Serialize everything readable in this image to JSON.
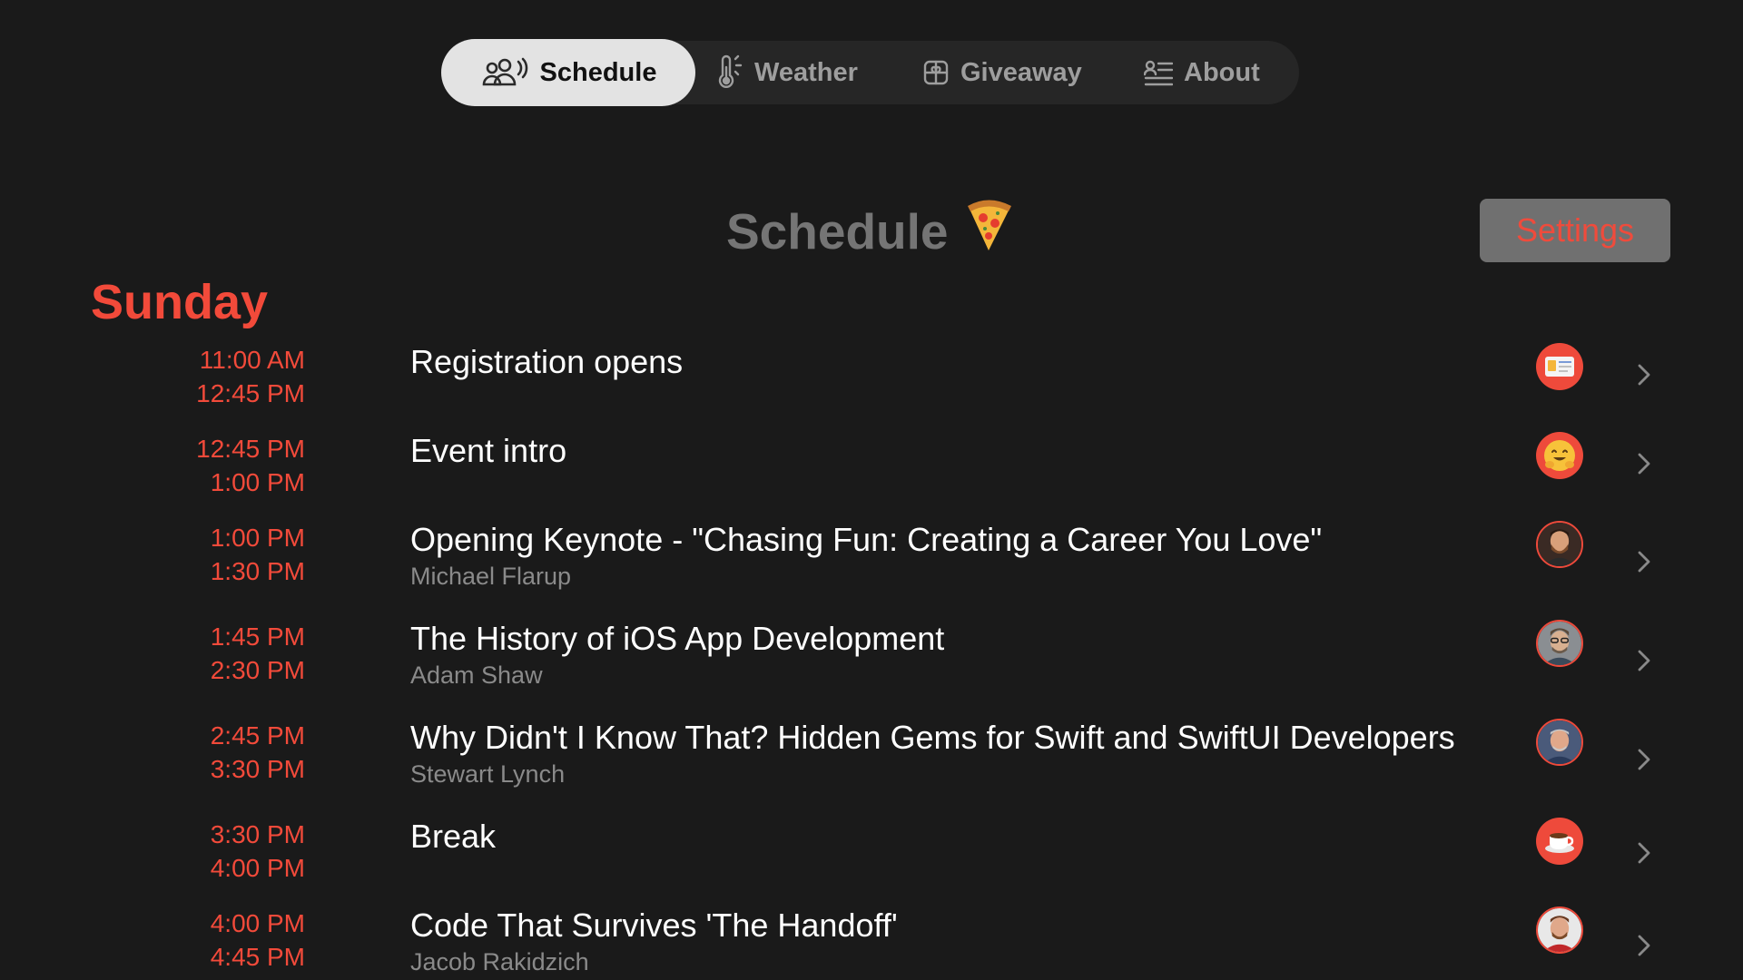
{
  "tabs": {
    "schedule": "Schedule",
    "weather": "Weather",
    "giveaway": "Giveaway",
    "about": "About",
    "active": "schedule"
  },
  "header": {
    "title": "Schedule",
    "title_emoji": "pizza-icon",
    "settings_label": "Settings"
  },
  "day": "Sunday",
  "events": [
    {
      "start": "11:00 AM",
      "end": "12:45 PM",
      "title": "Registration opens",
      "speaker": "",
      "avatar": "id-card-icon"
    },
    {
      "start": "12:45 PM",
      "end": "1:00 PM",
      "title": "Event intro",
      "speaker": "",
      "avatar": "hugging-face-icon"
    },
    {
      "start": "1:00 PM",
      "end": "1:30 PM",
      "title": "Opening Keynote - \"Chasing Fun: Creating a Career You Love\"",
      "speaker": "Michael Flarup",
      "avatar": "speaker-photo"
    },
    {
      "start": "1:45 PM",
      "end": "2:30 PM",
      "title": "The History of iOS App Development",
      "speaker": "Adam Shaw",
      "avatar": "speaker-photo"
    },
    {
      "start": "2:45 PM",
      "end": "3:30 PM",
      "title": "Why Didn't I Know That? Hidden Gems for Swift and SwiftUI Developers",
      "speaker": "Stewart Lynch",
      "avatar": "speaker-photo"
    },
    {
      "start": "3:30 PM",
      "end": "4:00 PM",
      "title": "Break",
      "speaker": "",
      "avatar": "coffee-icon"
    },
    {
      "start": "4:00 PM",
      "end": "4:45 PM",
      "title": "Code That Survives 'The Handoff'",
      "speaker": "Jacob Rakidzich",
      "avatar": "speaker-photo"
    }
  ],
  "colors": {
    "accent": "#f24a3a",
    "background": "#1a1a1a",
    "tab_bar": "#262626",
    "active_tab": "#e3e3e3",
    "settings_button": "#707070"
  }
}
